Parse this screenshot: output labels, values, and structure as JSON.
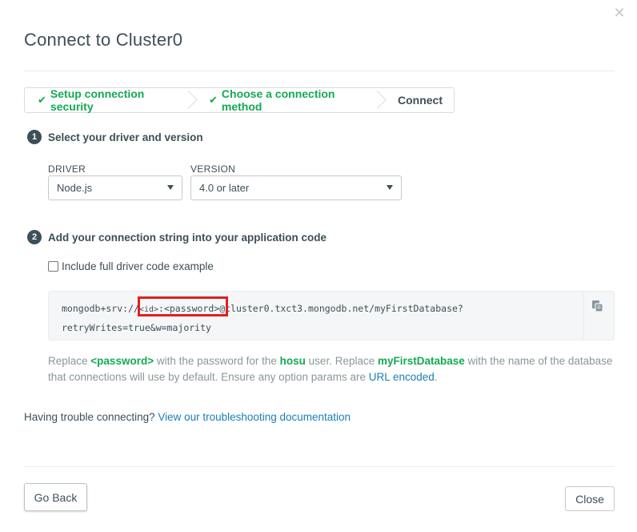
{
  "modal": {
    "title": "Connect to Cluster0",
    "close_icon": "close-icon"
  },
  "steps": [
    {
      "label": "Setup connection security",
      "status": "complete"
    },
    {
      "label": "Choose a connection method",
      "status": "complete"
    },
    {
      "label": "Connect",
      "status": "current"
    }
  ],
  "section1": {
    "number": "1",
    "title": "Select your driver and version",
    "driver_label": "DRIVER",
    "driver_value": "Node.js",
    "version_label": "VERSION",
    "version_value": "4.0 or later"
  },
  "section2": {
    "number": "2",
    "title": "Add your connection string into your application code",
    "checkbox_label": "Include full driver code example",
    "checkbox_checked": false,
    "code": {
      "prefix": "mongodb+srv://",
      "user_placeholder": "<id>",
      "password_part": ":<password>",
      "suffix_line1": "@cluster0.txct3.mongodb.net/myFirstDatabase?",
      "line2": "retryWrites=true&w=majority"
    },
    "help": {
      "t1": "Replace ",
      "password": "<password>",
      "t2": " with the password for the ",
      "user": "hosu",
      "t3": " user. Replace ",
      "db": "myFirstDatabase",
      "t4": " with the name of the database that connections will use by default. Ensure any option params are ",
      "link": "URL encoded",
      "t5": "."
    }
  },
  "trouble": {
    "text": "Having trouble connecting? ",
    "link": "View our troubleshooting documentation"
  },
  "footer": {
    "back_label": "Go Back",
    "close_label": "Close"
  },
  "colors": {
    "accent_green": "#13aa52",
    "link_blue": "#1a7fb5",
    "highlight_red": "#e02020",
    "text_dark": "#3d4f58"
  }
}
